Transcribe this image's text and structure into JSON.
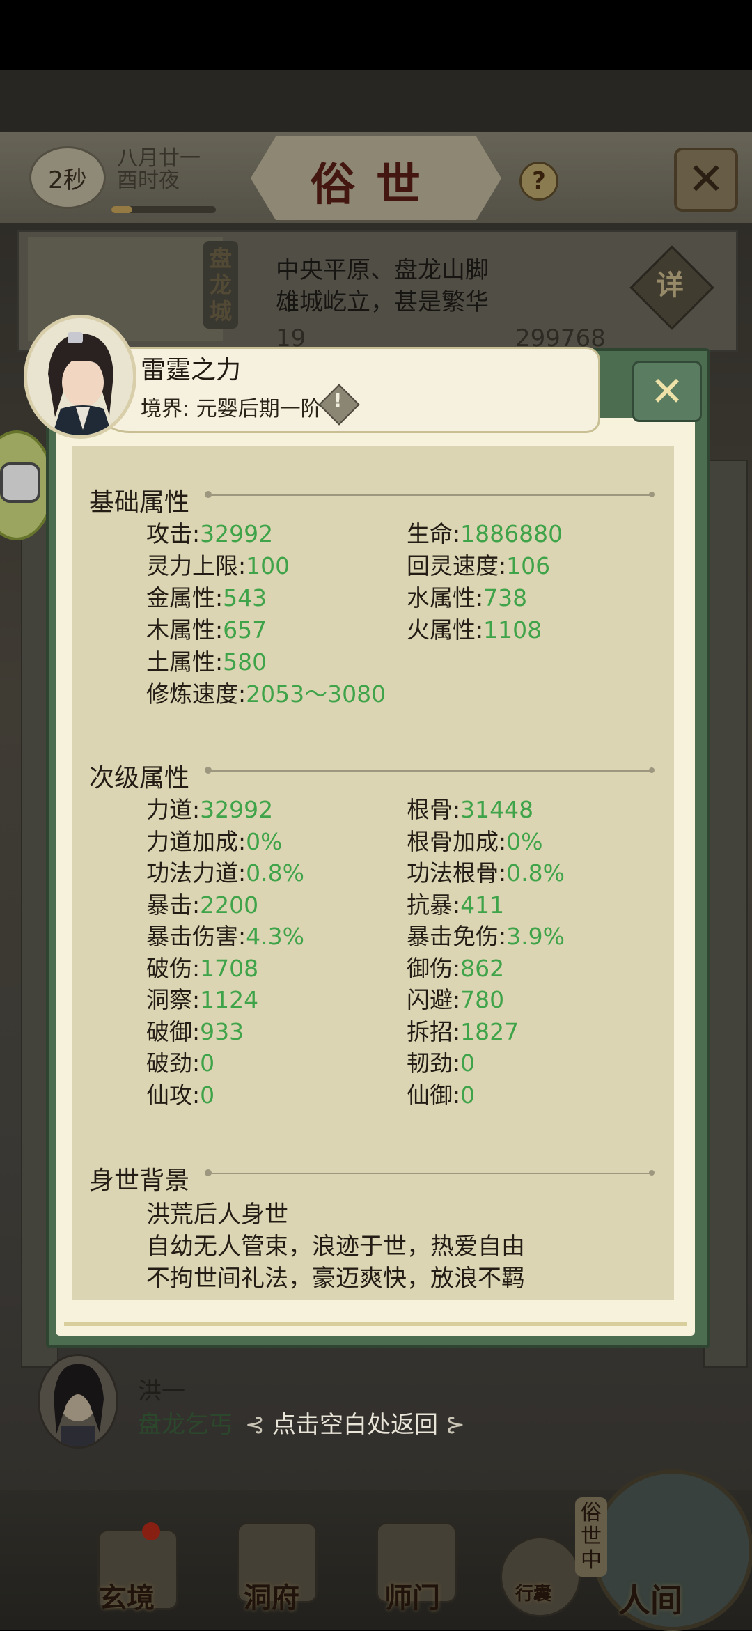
{
  "header": {
    "timer": "2秒",
    "date_line1": "八月廿一",
    "date_line2": "酉时夜",
    "title": "俗世",
    "help": "?",
    "close": "✕"
  },
  "location": {
    "city_vertical": "盘龙城",
    "line1": "中央平原、盘龙山脚",
    "line2": "雄城屹立，甚是繁华",
    "detail_label": "详",
    "resource_left": "19",
    "resource_right": "299768"
  },
  "character": {
    "name": "雷霆之力",
    "realm": "境界: 元婴后期一阶",
    "realm_icon": "!",
    "close": "✕"
  },
  "basic": {
    "title": "基础属性",
    "stats": [
      {
        "label": "攻击:",
        "value": "32992"
      },
      {
        "label": "生命:",
        "value": "1886880"
      },
      {
        "label": "灵力上限:",
        "value": "100"
      },
      {
        "label": "回灵速度:",
        "value": "106"
      },
      {
        "label": "金属性:",
        "value": "543"
      },
      {
        "label": "水属性:",
        "value": "738"
      },
      {
        "label": "木属性:",
        "value": "657"
      },
      {
        "label": "火属性:",
        "value": "1108"
      },
      {
        "label": "土属性:",
        "value": "580"
      },
      {
        "label": "修炼速度:",
        "value": "2053～3080"
      }
    ]
  },
  "secondary": {
    "title": "次级属性",
    "stats": [
      {
        "label": "力道:",
        "value": "32992"
      },
      {
        "label": "根骨:",
        "value": "31448"
      },
      {
        "label": "力道加成:",
        "value": "0%"
      },
      {
        "label": "根骨加成:",
        "value": "0%"
      },
      {
        "label": "功法力道:",
        "value": "0.8%"
      },
      {
        "label": "功法根骨:",
        "value": "0.8%"
      },
      {
        "label": "暴击:",
        "value": "2200"
      },
      {
        "label": "抗暴:",
        "value": "411"
      },
      {
        "label": "暴击伤害:",
        "value": "4.3%"
      },
      {
        "label": "暴击免伤:",
        "value": "3.9%"
      },
      {
        "label": "破伤:",
        "value": "1708"
      },
      {
        "label": "御伤:",
        "value": "862"
      },
      {
        "label": "洞察:",
        "value": "1124"
      },
      {
        "label": "闪避:",
        "value": "780"
      },
      {
        "label": "破御:",
        "value": "933"
      },
      {
        "label": "拆招:",
        "value": "1827"
      },
      {
        "label": "破劲:",
        "value": "0"
      },
      {
        "label": "韧劲:",
        "value": "0"
      },
      {
        "label": "仙攻:",
        "value": "0"
      },
      {
        "label": "仙御:",
        "value": "0"
      }
    ]
  },
  "background": {
    "title": "身世背景",
    "lines": [
      "洪荒后人身世",
      "自幼无人管束，浪迹于世，热爱自由",
      "不拘世间礼法，豪迈爽快，放浪不羁"
    ]
  },
  "npc": {
    "name": "洪一",
    "title": "盘龙乞丐"
  },
  "back_hint": "点击空白处返回",
  "nav": {
    "items": [
      "玄境",
      "洞府",
      "师门",
      "行囊"
    ],
    "world_vertical": "俗世中",
    "world_label": "人间"
  },
  "colors": {
    "stat_value": "#3fa349",
    "modal_frame": "#4d6d51",
    "paper": "#dcd5b3",
    "title_red": "#5a1f14"
  }
}
